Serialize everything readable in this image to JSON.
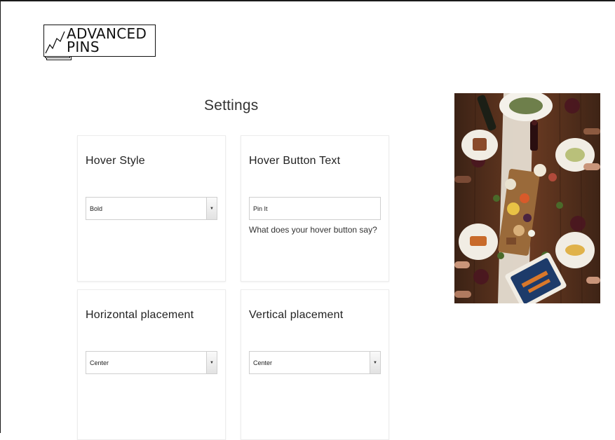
{
  "logo": {
    "line1": "ADVANCED",
    "line2": "PINS"
  },
  "page": {
    "title": "Settings"
  },
  "cards": {
    "hover_style": {
      "label": "Hover Style",
      "value": "Bold"
    },
    "hover_button_text": {
      "label": "Hover Button Text",
      "value": "Pin It",
      "help": "What does your hover button say?"
    },
    "horizontal_placement": {
      "label": "Horizontal placement",
      "value": "Center"
    },
    "vertical_placement": {
      "label": "Vertical placement",
      "value": "Center"
    }
  },
  "preview_image": {
    "subject": "overhead view of a dinner table with food platters"
  },
  "colors": {
    "frame": "#1a1a1a",
    "card_border": "#ececec",
    "input_border": "#cfcfcf"
  }
}
